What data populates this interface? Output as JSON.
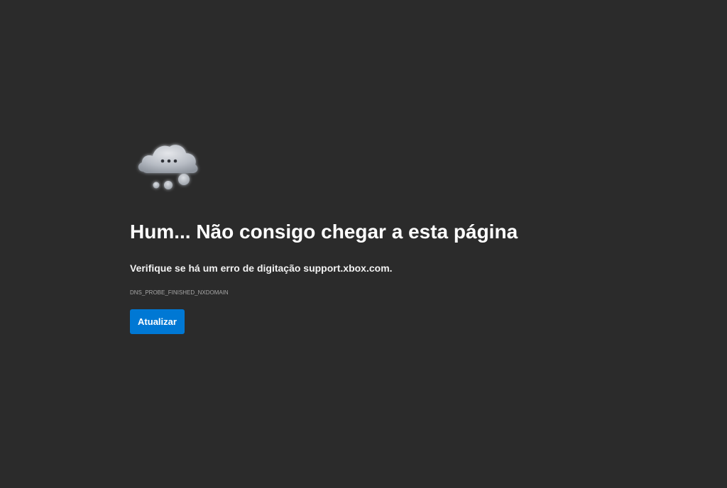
{
  "error": {
    "icon": "thinking-cloud-icon",
    "title": "Hum... Não consigo chegar a esta página",
    "hint": "Verifique se há um erro de digitação support.xbox.com.",
    "code": "DNS_PROBE_FINISHED_NXDOMAIN",
    "refresh_label": "Atualizar"
  },
  "colors": {
    "background": "#2b2b2b",
    "accent": "#0078d4",
    "text": "#ffffff",
    "muted": "#a6a6a6"
  }
}
